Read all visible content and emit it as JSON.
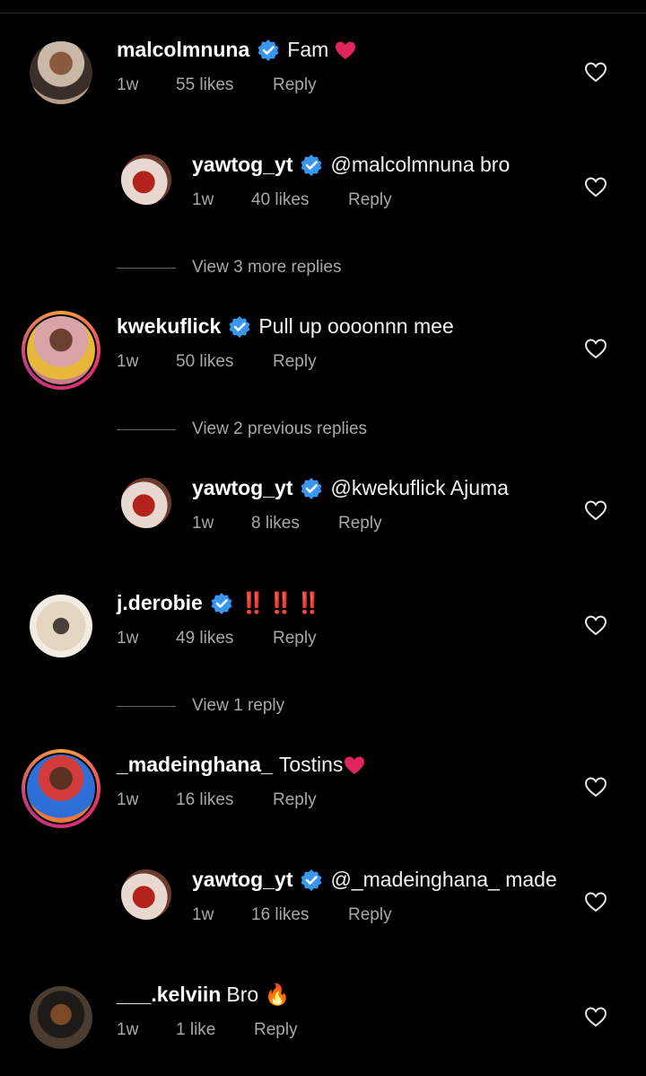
{
  "comments": [
    {
      "username": "malcolmnuna",
      "text": "Fam",
      "age": "1w",
      "likes": "55 likes",
      "reply": "Reply"
    },
    {
      "username": "yawtog_yt",
      "text": "@malcolmnuna bro",
      "age": "1w",
      "likes": "40 likes",
      "reply": "Reply"
    },
    {
      "username": "kwekuflick",
      "text": "Pull up oooonnn mee",
      "age": "1w",
      "likes": "50 likes",
      "reply": "Reply"
    },
    {
      "username": "yawtog_yt",
      "text": "@kwekuflick Ajuma",
      "age": "1w",
      "likes": "8 likes",
      "reply": "Reply"
    },
    {
      "username": "j.derobie",
      "text": "‼️ ‼️ ‼️",
      "age": "1w",
      "likes": "49 likes",
      "reply": "Reply"
    },
    {
      "username": "_madeinghana_",
      "text": "Tostins",
      "age": "1w",
      "likes": "16 likes",
      "reply": "Reply"
    },
    {
      "username": "yawtog_yt",
      "text": "@_madeinghana_ made",
      "age": "1w",
      "likes": "16 likes",
      "reply": "Reply"
    },
    {
      "username": "___.kelviin",
      "text": "Bro 🔥",
      "age": "1w",
      "likes": "1 like",
      "reply": "Reply"
    }
  ],
  "view_links": {
    "more_replies": "View 3 more replies",
    "previous_replies": "View 2 previous replies",
    "one_reply": "View 1 reply"
  },
  "colors": {
    "verified": "#3897f0",
    "heart_emoji": "#e0245e",
    "meta": "#a8a8a8"
  }
}
